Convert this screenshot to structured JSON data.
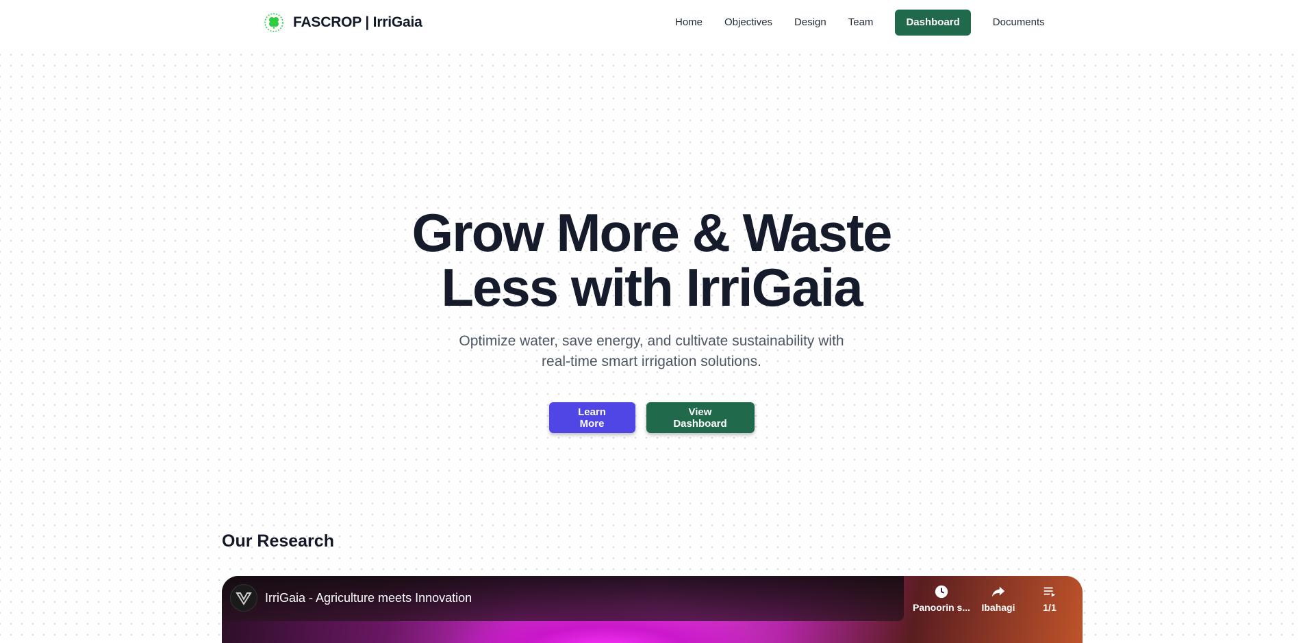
{
  "brand": {
    "name": "FASCROP | IrriGaia",
    "logo_icon": "clover-logo-icon",
    "logo_color": "#2ecc40"
  },
  "nav": {
    "items": [
      {
        "label": "Home"
      },
      {
        "label": "Objectives"
      },
      {
        "label": "Design"
      },
      {
        "label": "Team"
      },
      {
        "label": "Dashboard",
        "active": true
      },
      {
        "label": "Documents"
      }
    ],
    "active_color": "#20694a"
  },
  "hero": {
    "title_line1": "Grow More & Waste",
    "title_line2": "Less with IrriGaia",
    "subtitle_line1": "Optimize water, save energy, and cultivate sustainability with",
    "subtitle_line2": "real-time smart irrigation solutions.",
    "learn_more_label": "Learn More",
    "view_dashboard_label": "View Dashboard",
    "primary_color": "#4f46e5",
    "secondary_color": "#20694a"
  },
  "research": {
    "title": "Our Research",
    "video": {
      "title": "IrriGaia - Agriculture meets Innovation",
      "watch_later_label": "Panoorin s...",
      "share_label": "Ibahagi",
      "playlist_label": "1/1"
    }
  }
}
